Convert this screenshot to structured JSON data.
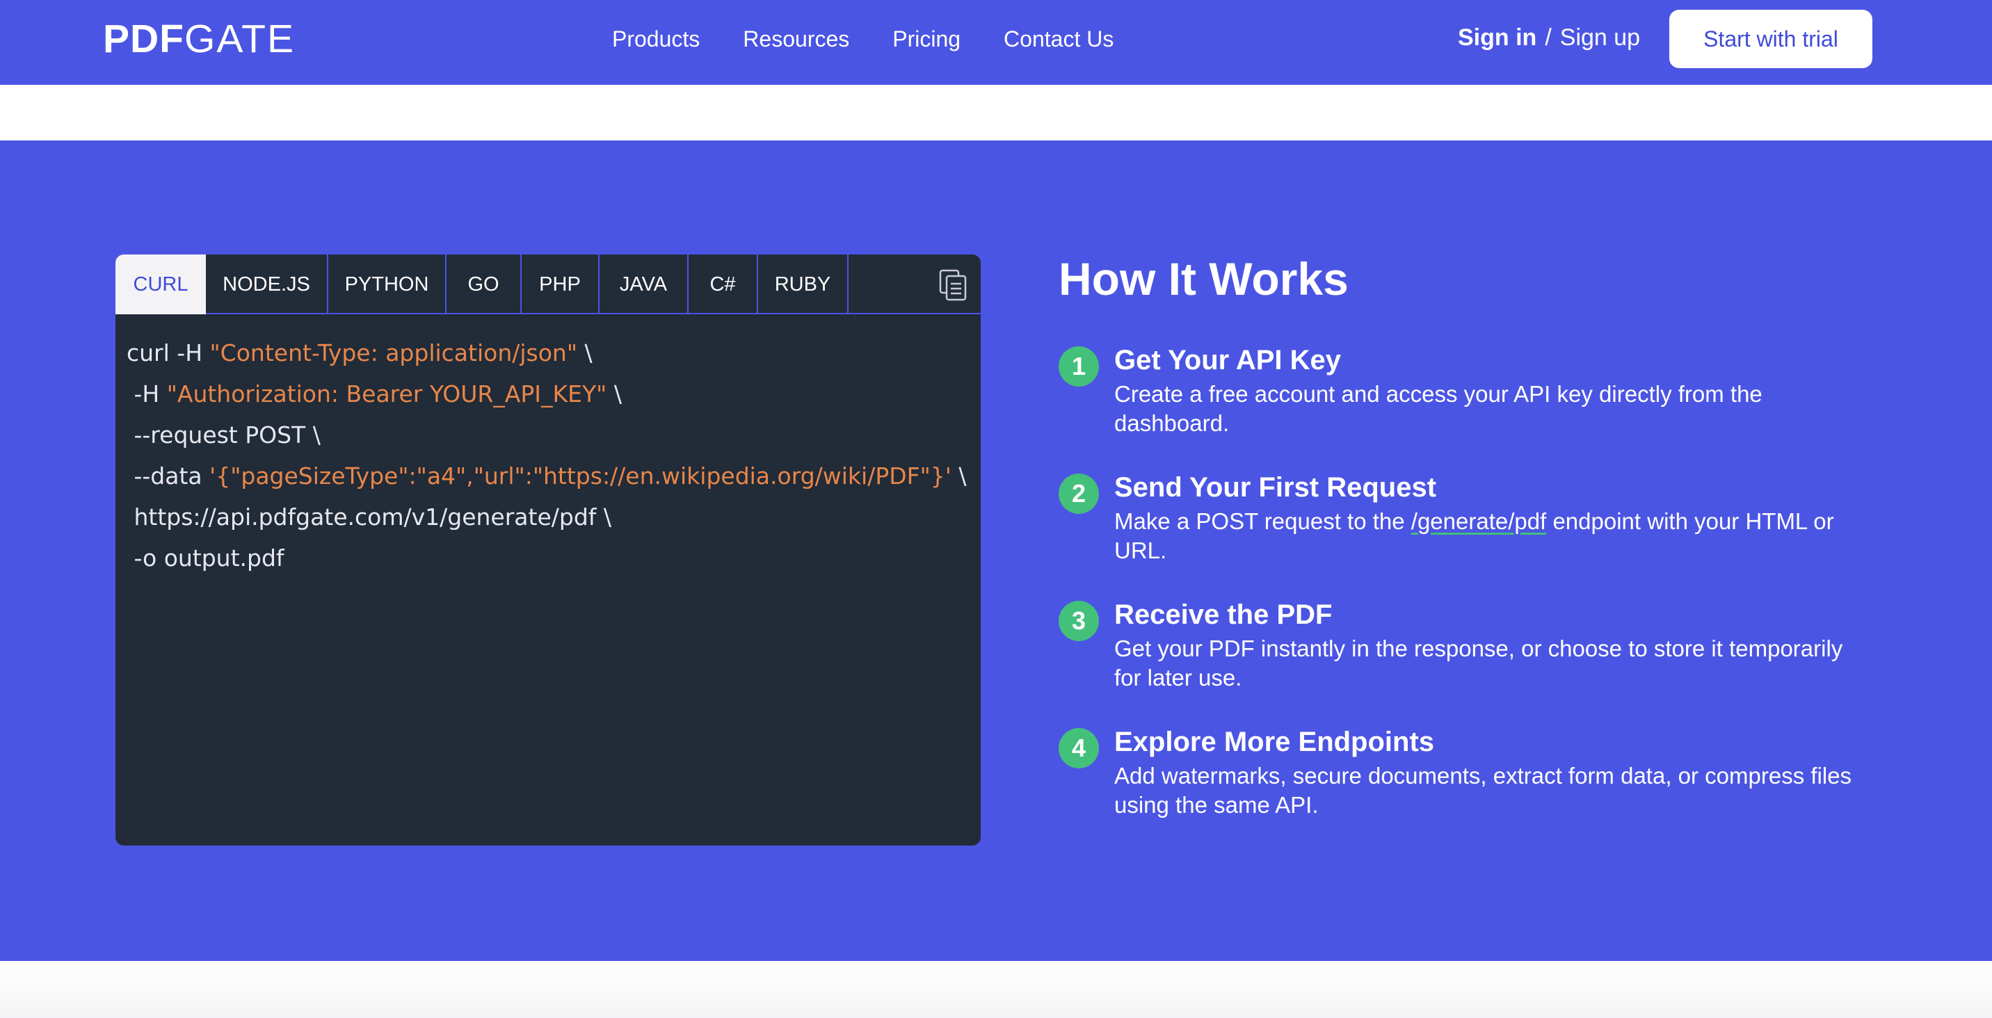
{
  "nav": {
    "logo_bold": "PDF",
    "logo_light": "GATE",
    "links": [
      "Products",
      "Resources",
      "Pricing",
      "Contact Us"
    ],
    "sign_in": "Sign in",
    "separator": "/",
    "sign_up": "Sign up",
    "trial_button": "Start with trial"
  },
  "code_panel": {
    "tabs": [
      "CURL",
      "NODE.JS",
      "PYTHON",
      "GO",
      "PHP",
      "JAVA",
      "C#",
      "RUBY"
    ],
    "active_tab": "CURL",
    "copy_icon": "copy-icon",
    "lines": [
      [
        {
          "t": "curl -H ",
          "k": "p"
        },
        {
          "t": "\"Content-Type: application/json\"",
          "k": "s"
        },
        {
          "t": " \\",
          "k": "p"
        }
      ],
      [
        {
          "t": " -H ",
          "k": "p"
        },
        {
          "t": "\"Authorization: Bearer YOUR_API_KEY\"",
          "k": "s"
        },
        {
          "t": " \\",
          "k": "p"
        }
      ],
      [
        {
          "t": " --request POST \\",
          "k": "p"
        }
      ],
      [
        {
          "t": " --data ",
          "k": "p"
        },
        {
          "t": "'{\"pageSizeType\":\"a4\",\"url\":\"https://en.wikipedia.org/wiki/PDF\"}'",
          "k": "s"
        },
        {
          "t": " \\",
          "k": "p"
        }
      ],
      [
        {
          "t": " https://api.pdfgate.com/v1/generate/pdf \\",
          "k": "p"
        }
      ],
      [
        {
          "t": " -o output.pdf",
          "k": "p"
        }
      ]
    ]
  },
  "how": {
    "title": "How It Works",
    "steps": [
      {
        "num": "1",
        "title": "Get Your API Key",
        "desc": "Create a free account and access your API key directly from the dashboard."
      },
      {
        "num": "2",
        "title": "Send Your First Request",
        "desc_before": "Make a POST request to the ",
        "desc_link": "/generate/pdf",
        "desc_after": " endpoint with your HTML or URL."
      },
      {
        "num": "3",
        "title": "Receive the PDF",
        "desc": "Get your PDF instantly in the response, or choose to store it temporarily for later use."
      },
      {
        "num": "4",
        "title": "Explore More Endpoints",
        "desc": "Add watermarks, secure documents, extract form data, or compress files using the same API."
      }
    ]
  },
  "colors": {
    "brand": "#4b55e3",
    "code_bg": "#222b38",
    "string": "#e8874a",
    "step_badge": "#43c07a"
  }
}
